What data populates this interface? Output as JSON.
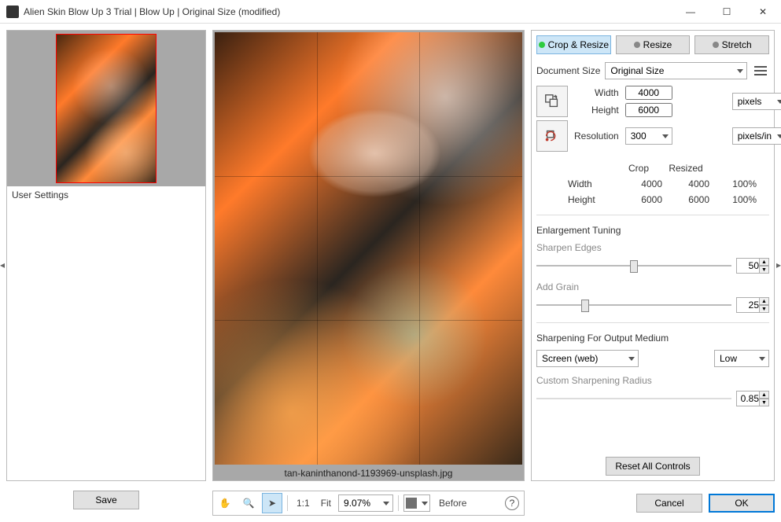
{
  "window": {
    "title": "Alien Skin Blow Up 3 Trial | Blow Up | Original Size (modified)"
  },
  "left": {
    "user_settings": "User Settings",
    "save": "Save"
  },
  "center": {
    "filename": "tan-kaninthanond-1193969-unsplash.jpg",
    "toolbar": {
      "one_to_one": "1:1",
      "fit": "Fit",
      "zoom_value": "9.07%",
      "before": "Before"
    }
  },
  "right": {
    "tabs": {
      "crop_resize": "Crop & Resize",
      "resize": "Resize",
      "stretch": "Stretch"
    },
    "doc_size_label": "Document Size",
    "doc_size_value": "Original Size",
    "width_label": "Width",
    "height_label": "Height",
    "resolution_label": "Resolution",
    "width_value": "4000",
    "height_value": "6000",
    "resolution_value": "300",
    "units_pixels": "pixels",
    "units_res": "pixels/in",
    "table": {
      "crop_hdr": "Crop",
      "resized_hdr": "Resized",
      "width": "Width",
      "height": "Height",
      "w_crop": "4000",
      "w_res": "4000",
      "w_pct": "100%",
      "h_crop": "6000",
      "h_res": "6000",
      "h_pct": "100%"
    },
    "enlargement_title": "Enlargement Tuning",
    "sharpen_label": "Sharpen Edges",
    "sharpen_value": "50",
    "grain_label": "Add Grain",
    "grain_value": "25",
    "output_title": "Sharpening For Output Medium",
    "output_medium": "Screen (web)",
    "output_level": "Low",
    "custom_radius_label": "Custom Sharpening Radius",
    "custom_radius_value": "0.85",
    "reset": "Reset All Controls",
    "cancel": "Cancel",
    "ok": "OK"
  }
}
